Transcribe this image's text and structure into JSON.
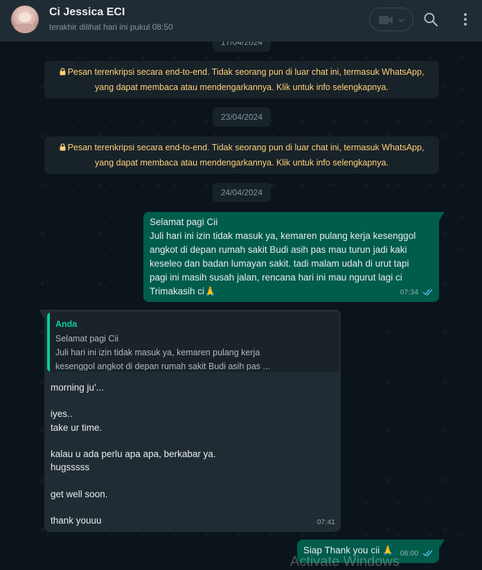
{
  "header": {
    "contact_name": "Ci Jessica ECI",
    "status": "terakhir dilihat hari ini pukul 08:50",
    "icons": [
      "avatar",
      "video-call-icon",
      "chevron-down-icon",
      "search-icon",
      "menu-icon"
    ]
  },
  "chat": {
    "date_chips": [
      "17/04/2024",
      "23/04/2024",
      "24/04/2024"
    ],
    "system_messages": [
      {
        "line1": "Pesan terenkripsi secara end-to-end. Tidak seorang pun di luar chat ini, termasuk WhatsApp,",
        "line2": "yang dapat membaca atau mendengarkannya. Klik untuk info selengkapnya."
      },
      {
        "line1": "Pesan terenkripsi secara end-to-end. Tidak seorang pun di luar chat ini, termasuk WhatsApp,",
        "line2": "yang dapat membaca atau mendengarkannya. Klik untuk info selengkapnya."
      }
    ],
    "messages": [
      {
        "direction": "outgoing",
        "text": "Selamat pagi Cii\nJuli hari ini izin tidak masuk ya, kemaren pulang kerja kesenggol\nangkot di depan rumah sakit Budi asih pas mau turun jadi kaki\nkeseleo dan badan lumayan sakit. tadi malam udah di urut tapi\npagi ini masih susah jalan, rencana hari ini mau ngurut lagi ci\nTrimakasih ci🙏",
        "time": "07:34",
        "status": "read"
      },
      {
        "direction": "incoming",
        "quote_author": "Anda",
        "quote_text": "Selamat pagi Cii\nJuli hari ini izin tidak masuk ya, kemaren pulang kerja\nkesenggol angkot di depan rumah sakit Budi asih pas ...",
        "text": "morning ju'...\n\niyes..\ntake ur time.\n\nkalau u ada perlu apa apa, berkabar ya.\nhugsssss\n\nget well soon.\n\nthank youuu",
        "time": "07:41"
      },
      {
        "direction": "outgoing",
        "text": "Siap Thank you cii 🙏",
        "time": "08:00",
        "status": "read"
      }
    ]
  },
  "overlay": {
    "watermark": "Activate Windows"
  },
  "colors": {
    "header_bg": "#202c33",
    "chat_bg": "#0b141a",
    "outgoing_bubble": "#005c4b",
    "incoming_bubble": "#202c33",
    "system_text": "#ffd279",
    "read_ticks": "#53bdeb",
    "quote_accent": "#06cf9c"
  }
}
